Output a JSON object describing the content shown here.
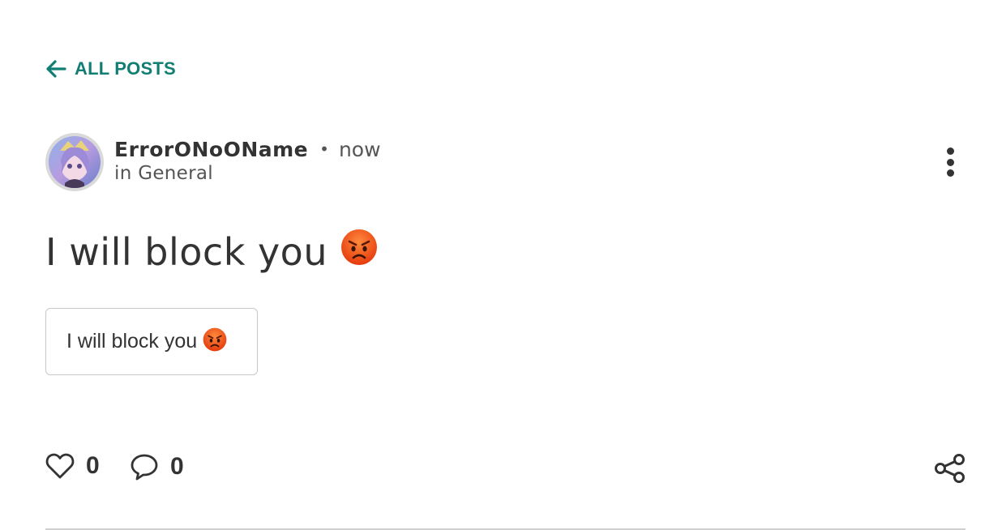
{
  "back_link": {
    "label": "ALL POSTS",
    "icon": "arrow-left-icon"
  },
  "post": {
    "author": "ErrorONoOName",
    "separator": "•",
    "time": "now",
    "category_prefix": "in",
    "category": "General",
    "title": "I will block you",
    "title_emoji": "angry-face",
    "preview_text": "I will block you",
    "preview_emoji": "angry-face",
    "likes": "0",
    "comments": "0"
  },
  "icons": {
    "more": "more-vertical-icon",
    "like": "heart-icon",
    "comment": "comment-icon",
    "share": "share-icon"
  },
  "colors": {
    "accent": "#117e74",
    "text": "#333333",
    "muted": "#555555",
    "emoji_face": "#f4511e"
  }
}
